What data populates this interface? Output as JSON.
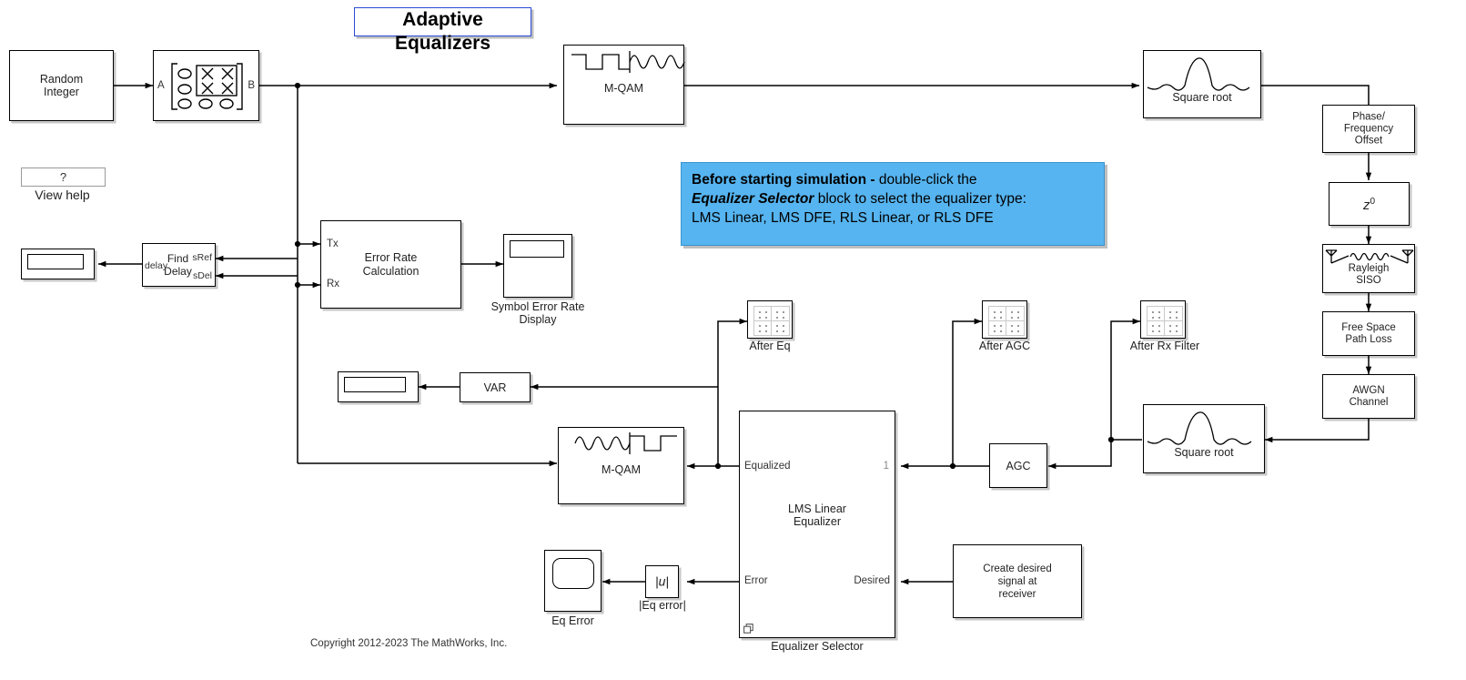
{
  "title": {
    "text": "Adaptive Equalizers",
    "border_color": "#2a4bd6"
  },
  "copyright": "Copyright 2012-2023 The MathWorks, Inc.",
  "help": {
    "button_label": "?",
    "caption": "View help"
  },
  "note": {
    "lead_bold": "Before starting simulation - ",
    "line1_rest": "double-click the",
    "emphasis": "Equalizer Selector",
    "line2_rest": " block to select the equalizer type:",
    "line3": "LMS Linear, LMS DFE, RLS Linear, or RLS DFE",
    "bg_color": "#56b4f0"
  },
  "blocks": {
    "random_integer": {
      "label": "Random\nInteger"
    },
    "bit_to_integer": {
      "label": "",
      "port_in": "A",
      "port_out": "B"
    },
    "mqam_mod": {
      "label": "M-QAM"
    },
    "tx_filter": {
      "label": "Square root"
    },
    "phase_freq_offset": {
      "label": "Phase/\nFrequency\nOffset"
    },
    "variable_delay": {
      "label": "z",
      "exponent": "0"
    },
    "rayleigh": {
      "label": "Rayleigh\nSISO"
    },
    "free_space": {
      "label": "Free Space\nPath Loss"
    },
    "awgn": {
      "label": "AWGN\nChannel"
    },
    "rx_filter": {
      "label": "Square root"
    },
    "agc": {
      "label": "AGC"
    },
    "equalizer_selector": {
      "label": "LMS Linear\nEqualizer",
      "caption": "Equalizer Selector",
      "port_equalized": "Equalized",
      "port_error": "Error",
      "port_one": "1",
      "port_desired": "Desired"
    },
    "create_desired": {
      "label": "Create desired\nsignal at\nreceiver"
    },
    "mqam_demod": {
      "label": "M-QAM"
    },
    "find_delay": {
      "label": "Find\nDelay",
      "port_in": "delay",
      "port_sref": "sRef",
      "port_sdel": "sDel"
    },
    "delay_display": {
      "label": ""
    },
    "error_rate": {
      "label": "Error Rate\nCalculation",
      "port_tx": "Tx",
      "port_rx": "Rx"
    },
    "ser_display": {
      "caption": "Symbol Error Rate\nDisplay"
    },
    "var_block": {
      "label": "VAR"
    },
    "var_display": {
      "label": ""
    },
    "abs_block": {
      "label": "|u|",
      "caption": "|Eq error|"
    },
    "eq_error_scope": {
      "caption": "Eq Error"
    },
    "after_eq_scope": {
      "caption": "After Eq"
    },
    "after_agc_scope": {
      "caption": "After AGC"
    },
    "after_rx_filter_scope": {
      "caption": "After Rx Filter"
    }
  }
}
